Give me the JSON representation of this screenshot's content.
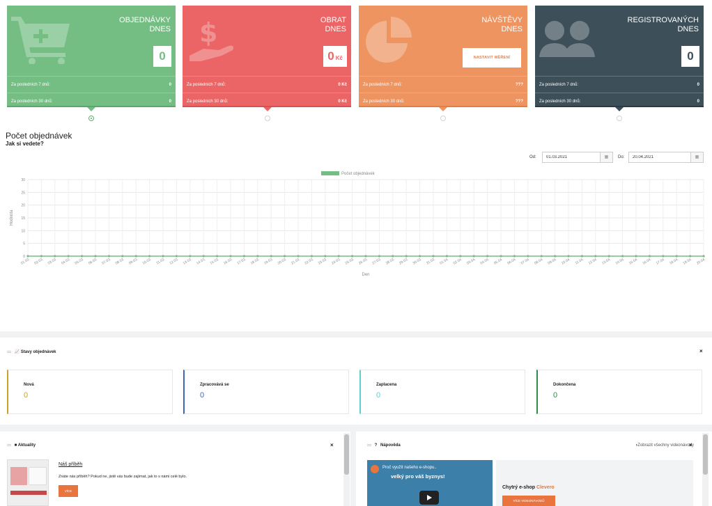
{
  "cards": [
    {
      "title_line1": "OBJEDNÁVKY",
      "title_line2": "DNES",
      "value": "0",
      "unit": "",
      "row1_label": "Za posledních 7 dnů:",
      "row1_value": "0",
      "row2_label": "Za posledních 30 dnů:",
      "row2_value": "0",
      "color": "#74be84",
      "value_color": "#74be84",
      "icon": "shopping-cart-icon"
    },
    {
      "title_line1": "OBRAT",
      "title_line2": "DNES",
      "value": "0",
      "unit": "Kč",
      "row1_label": "Za posledních 7 dnů:",
      "row1_value": "0 Kč",
      "row2_label": "Za posledních 30 dnů:",
      "row2_value": "0 Kč",
      "color": "#ec6566",
      "value_color": "#ec6566",
      "icon": "money-hand-icon"
    },
    {
      "title_line1": "NÁVŠTĚVY",
      "title_line2": "DNES",
      "button": "NASTAVIT MĚŘENÍ",
      "row1_label": "Za posledních 7 dnů:",
      "row1_value": "???",
      "row2_label": "Za posledních 30 dnů:",
      "row2_value": "???",
      "color": "#ee9461",
      "icon": "pie-chart-icon"
    },
    {
      "title_line1": "REGISTROVANÝCH",
      "title_line2": "DNES",
      "value": "0",
      "unit": "",
      "row1_label": "Za posledních 7 dnů:",
      "row1_value": "0",
      "row2_label": "Za posledních 30 dnů:",
      "row2_value": "0",
      "color": "#3d4f59",
      "value_color": "#3d4f59",
      "icon": "users-icon"
    }
  ],
  "orders": {
    "title": "Počet objednávek",
    "subtitle": "Jak si vedete?",
    "from_label": "Od:",
    "from_value": "01.03.2021",
    "to_label": "Do:",
    "to_value": "20.04.2021"
  },
  "chart_data": {
    "type": "line",
    "legend": "Počet objednávek",
    "legend_position": "top-center",
    "xlabel": "Den",
    "ylabel": "Hodnota",
    "ylim": [
      0,
      30
    ],
    "yticks": [
      0,
      5,
      10,
      15,
      20,
      25,
      30
    ],
    "grid": true,
    "color": "#74be84",
    "x": [
      "01.03.",
      "02.03.",
      "03.03.",
      "04.03.",
      "05.03.",
      "06.03.",
      "07.03.",
      "08.03.",
      "09.03.",
      "10.03.",
      "11.03.",
      "12.03.",
      "13.03.",
      "14.03.",
      "15.03.",
      "16.03.",
      "17.03.",
      "18.03.",
      "19.03.",
      "20.03.",
      "21.03.",
      "22.03.",
      "23.03.",
      "24.03.",
      "25.03.",
      "26.03.",
      "27.03.",
      "28.03.",
      "29.03.",
      "30.03.",
      "31.03.",
      "01.04.",
      "02.04.",
      "03.04.",
      "04.04.",
      "05.04.",
      "06.04.",
      "07.04.",
      "08.04.",
      "09.04.",
      "10.04.",
      "11.04.",
      "12.04.",
      "13.04.",
      "14.04.",
      "15.04.",
      "16.04.",
      "17.04.",
      "18.04.",
      "19.04.",
      "20.04."
    ],
    "series": [
      {
        "name": "Počet objednávek",
        "values": [
          0,
          0,
          0,
          0,
          0,
          0,
          0,
          0,
          0,
          0,
          0,
          0,
          0,
          0,
          0,
          0,
          0,
          0,
          0,
          0,
          0,
          0,
          0,
          0,
          0,
          0,
          0,
          0,
          0,
          0,
          0,
          0,
          0,
          0,
          0,
          0,
          0,
          0,
          0,
          0,
          0,
          0,
          0,
          0,
          0,
          0,
          0,
          0,
          0,
          0,
          0
        ]
      }
    ]
  },
  "states": {
    "title": "Stavy objednávek",
    "icon": "line-chart-icon",
    "close": "×",
    "items": [
      {
        "name": "Nová",
        "value": "0",
        "color": "#c9a227"
      },
      {
        "name": "Zpracovává se",
        "value": "0",
        "color": "#3f66b5"
      },
      {
        "name": "Zaplacena",
        "value": "0",
        "color": "#5fd0cf"
      },
      {
        "name": "Dokončena",
        "value": "0",
        "color": "#2e8b4a"
      }
    ]
  },
  "news": {
    "title": "Aktuality",
    "close": "×",
    "link": "Náš příběh",
    "text": "Znáte nás příběh? Pokud ne, jistě vás bude zajímat, jak to s námi celé bylo.",
    "more": "VÍCE"
  },
  "help": {
    "title": "Nápověda",
    "title_icon": "?",
    "show_all": "Zobrazit všechny videonávody",
    "close": "×",
    "video_title": "Proč využít našeho e-shopu..",
    "video_caption": "velký pro váš byznys!",
    "eshop_text": "Chytrý e-shop",
    "eshop_brand": "Clevero",
    "video_button": "VÍCE VIDEONÁVODŮ"
  }
}
